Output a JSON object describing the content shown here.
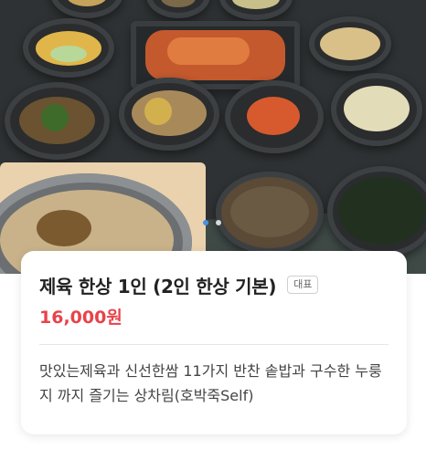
{
  "menu": {
    "title": "제육 한상 1인 (2인 한상 기본)",
    "badge": "대표",
    "price": "16,000원",
    "description": "맛있는제육과 신선한쌈 11가지 반찬 솥밥과 구수한 누룽지 까지 즐기는 상차림(호박죽Self)"
  },
  "gallery": {
    "active_index": 0,
    "count": 2,
    "active_color": "#4a90e2",
    "inactive_color": "#d8d8d8"
  }
}
